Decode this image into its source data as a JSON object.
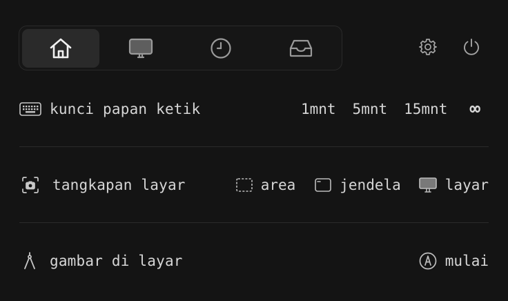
{
  "tabs": [
    {
      "name": "home",
      "icon": "home-icon",
      "active": true
    },
    {
      "name": "display",
      "icon": "monitor-icon",
      "active": false
    },
    {
      "name": "history",
      "icon": "clock-icon",
      "active": false
    },
    {
      "name": "inbox",
      "icon": "inbox-icon",
      "active": false
    }
  ],
  "top_actions": {
    "settings_icon": "gear-icon",
    "power_icon": "power-icon"
  },
  "keyboard_lock": {
    "icon": "keyboard-icon",
    "label": "kunci papan ketik",
    "options": [
      "1mnt",
      "5mnt",
      "15mnt",
      "∞"
    ]
  },
  "screenshot": {
    "icon": "camera-icon",
    "label": "tangkapan layar",
    "options": [
      {
        "icon": "area-select-icon",
        "label": "area"
      },
      {
        "icon": "window-icon",
        "label": "jendela"
      },
      {
        "icon": "monitor-icon",
        "label": "layar"
      }
    ]
  },
  "draw": {
    "icon": "compass-icon",
    "label": "gambar di layar",
    "action": {
      "icon": "pen-circle-icon",
      "label": "mulai"
    }
  },
  "colors": {
    "background": "#141414",
    "active_tab": "#2a2a2a",
    "text": "#d6d6d6"
  }
}
